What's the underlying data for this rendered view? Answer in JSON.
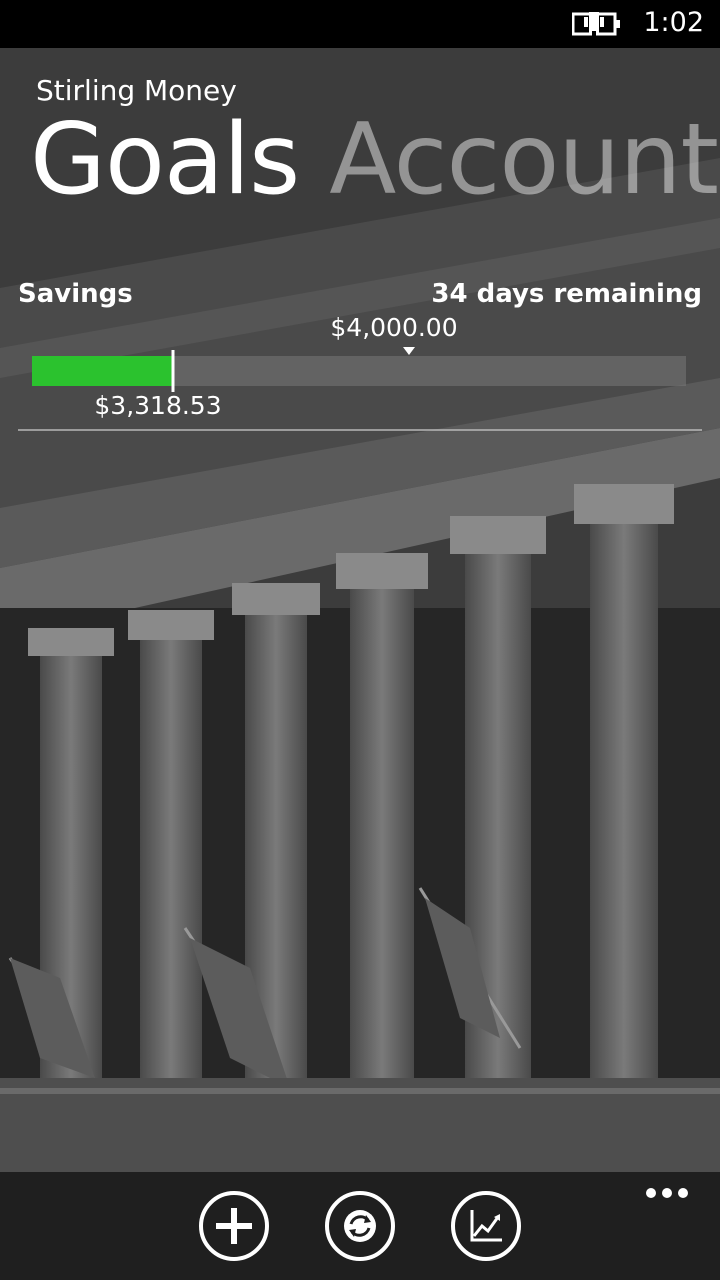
{
  "status_bar": {
    "time": "1:02",
    "battery_icon": "battery-charging-icon"
  },
  "app": {
    "title": "Stirling Money"
  },
  "pivot": {
    "tabs": [
      {
        "label": "Goals",
        "active": true
      },
      {
        "label": "Account",
        "active": false
      }
    ]
  },
  "goal": {
    "name": "Savings",
    "remaining": "34 days remaining",
    "target_label": "$4,000.00",
    "current_label": "$3,318.53",
    "progress_fraction": 0.215,
    "target_fraction": 0.577,
    "progress_color": "#2bc22e"
  },
  "app_bar": {
    "buttons": [
      {
        "icon": "add-icon"
      },
      {
        "icon": "sync-icon"
      },
      {
        "icon": "chart-icon"
      }
    ],
    "more_icon": "more-dots-icon"
  }
}
